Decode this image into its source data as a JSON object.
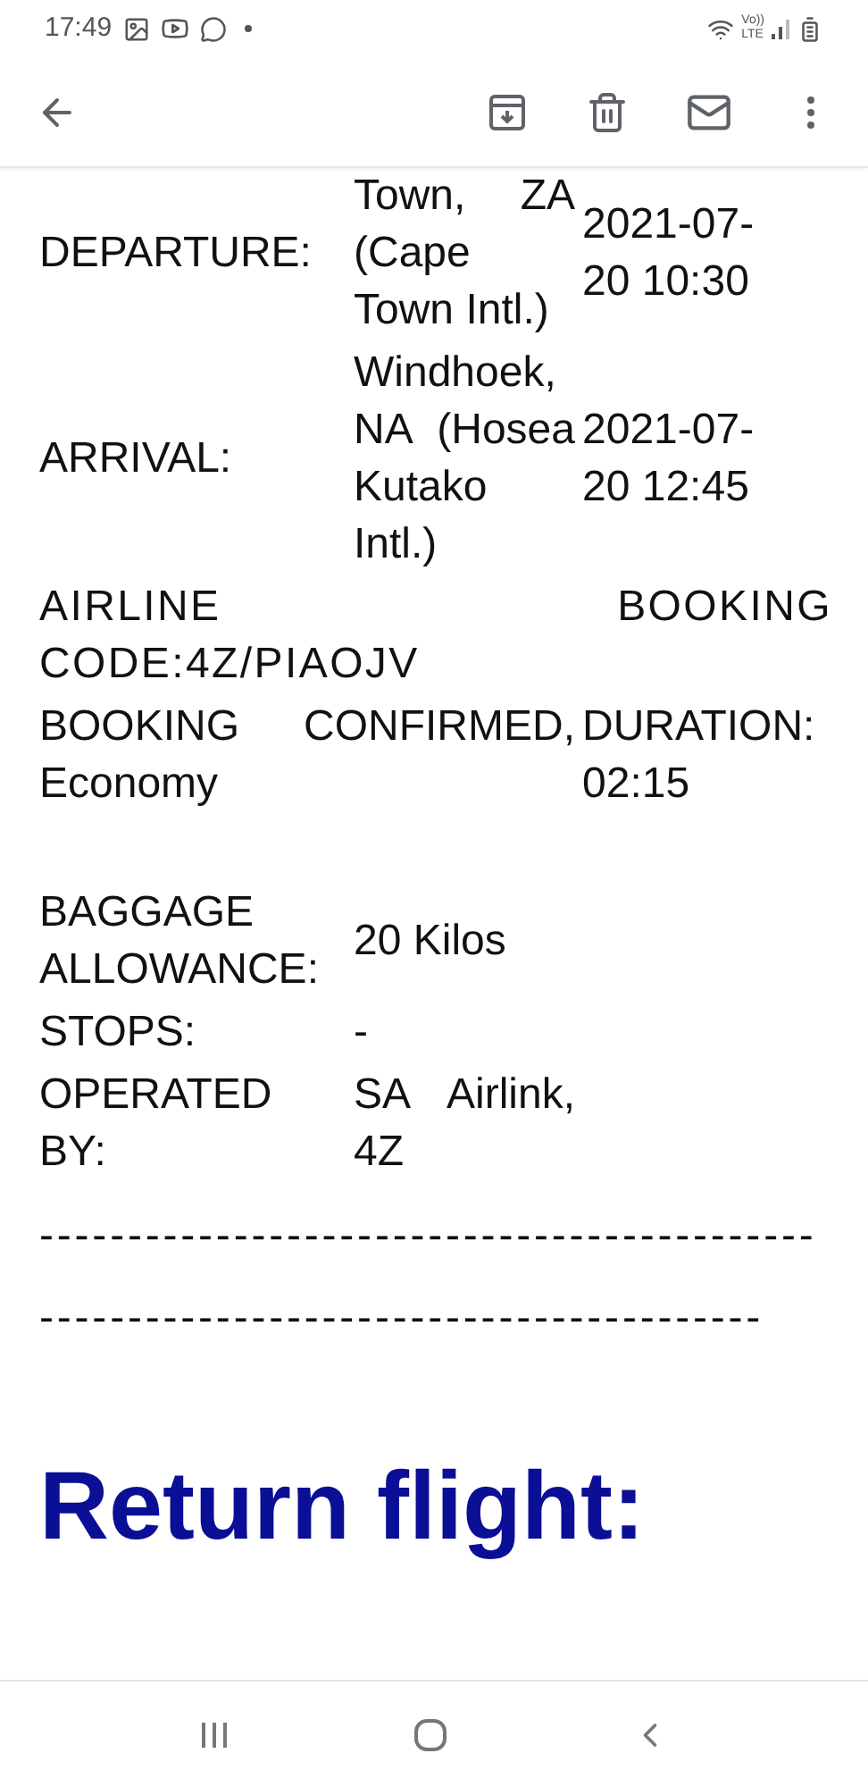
{
  "status_bar": {
    "time": "17:49",
    "network_label": [
      "Vo))",
      "LTE"
    ]
  },
  "rows": [
    {
      "kind": "three",
      "cells": [
        "DEPARTURE:",
        "Town, ZA (Cape Town Intl.)",
        "2021-07-20 10:30"
      ]
    },
    {
      "kind": "three",
      "cells": [
        "ARRIVAL:",
        "Windhoek, NA (Hosea Kutako Intl.)",
        "2021-07-20 12:45"
      ]
    },
    {
      "kind": "full",
      "cells": [
        "AIRLINE BOOKING CODE:4Z/PIAOJV"
      ]
    },
    {
      "kind": "wide",
      "cells": [
        "BOOKING CONFIRMED, Economy",
        "DURATION: 02:15"
      ]
    },
    {
      "kind": "gap",
      "cells": []
    },
    {
      "kind": "three",
      "cells": [
        "BAGGAGE ALLOWANCE:",
        "20 Kilos",
        ""
      ]
    },
    {
      "kind": "three",
      "cells": [
        "STOPS:",
        "-",
        ""
      ]
    },
    {
      "kind": "three",
      "cells": [
        "OPERATED BY:",
        "SA Airlink, 4Z",
        ""
      ]
    }
  ],
  "separator": "-------------------------------------------------------------------------------------",
  "section_heading": "Return flight:"
}
